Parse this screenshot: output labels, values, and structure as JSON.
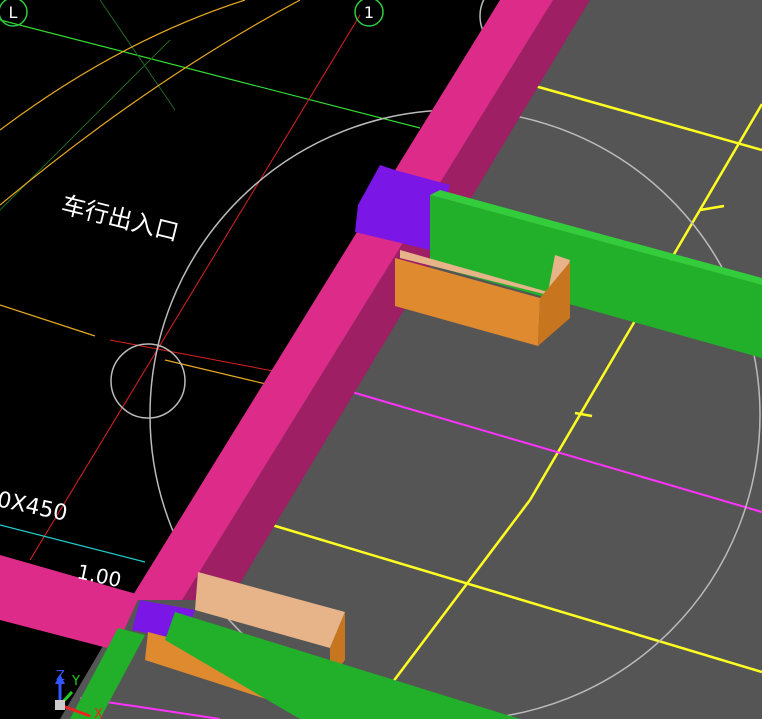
{
  "viewport": {
    "background_dark": "#000000",
    "background_floor": "#555555"
  },
  "axis_markers": {
    "left_label": "L",
    "right_label": "1",
    "marker_color": "#2ecc40"
  },
  "annotations": {
    "entrance_label": "车行出入口",
    "beam_size_label": "0X450",
    "elevation_label": "1.00"
  },
  "ucs_icon": {
    "z_label": "Z",
    "y_label": "Y",
    "x_label": "X"
  },
  "colors": {
    "magenta_beam": "#dd2b8a",
    "magenta_beam_side": "#9e1f63",
    "green_beam": "#22b02a",
    "orange_wall": "#e08a30",
    "orange_wall_top": "#e6b488",
    "purple_column": "#7a16e6",
    "yellow_grid": "#ffff22",
    "magenta_line": "#ff33ff"
  }
}
